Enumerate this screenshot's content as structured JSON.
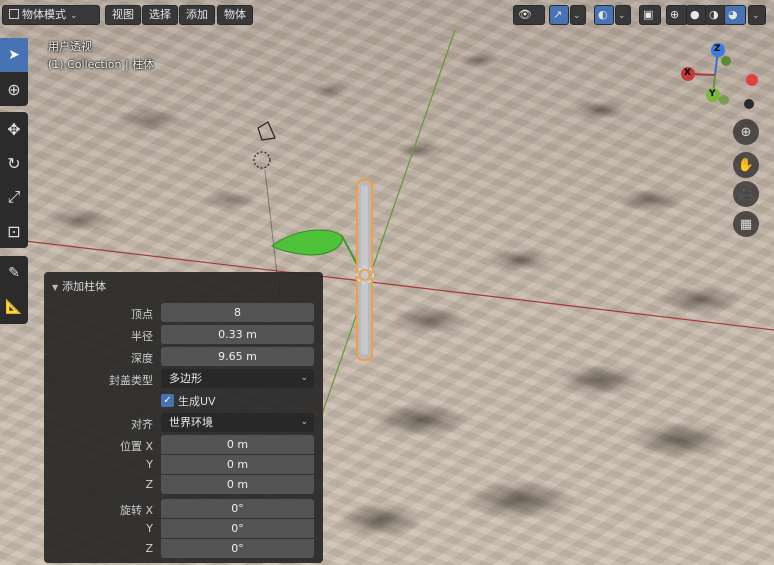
{
  "header": {
    "mode_select": "物体模式",
    "menus": [
      "视图",
      "选择",
      "添加",
      "物体"
    ]
  },
  "viewport": {
    "perspective_label": "用户透视",
    "collection_label": "(1) Collection | 柱体"
  },
  "gizmo": {
    "x_label": "X",
    "y_label": "Y",
    "z_label": "Z"
  },
  "toolbar": {
    "tools": [
      "select-box-icon",
      "cursor-icon",
      "move-icon",
      "rotate-icon",
      "scale-icon",
      "transform-icon",
      "annotate-icon",
      "measure-icon"
    ]
  },
  "nav": {
    "buttons": [
      "zoom-icon",
      "pan-hand-icon",
      "camera-icon",
      "perspective-grid-icon"
    ]
  },
  "panel": {
    "title": "添加柱体",
    "vertices_label": "顶点",
    "vertices_value": "8",
    "radius_label": "半径",
    "radius_value": "0.33 m",
    "depth_label": "深度",
    "depth_value": "9.65 m",
    "cap_label": "封盖类型",
    "cap_value": "多边形",
    "uv_label": "生成UV",
    "uv_checked": true,
    "align_label": "对齐",
    "align_value": "世界环境",
    "location_label": "位置 X",
    "location_y_label": "Y",
    "location_z_label": "Z",
    "location_x": "0 m",
    "location_y": "0 m",
    "location_z": "0 m",
    "rotation_label": "旋转 X",
    "rotation_y_label": "Y",
    "rotation_z_label": "Z",
    "rotation_x": "0°",
    "rotation_y": "0°",
    "rotation_z": "0°"
  },
  "colors": {
    "accent": "#4772b3",
    "axis_x": "#c23a3a",
    "axis_y": "#6a9f3a",
    "selection": "#f0a040"
  }
}
